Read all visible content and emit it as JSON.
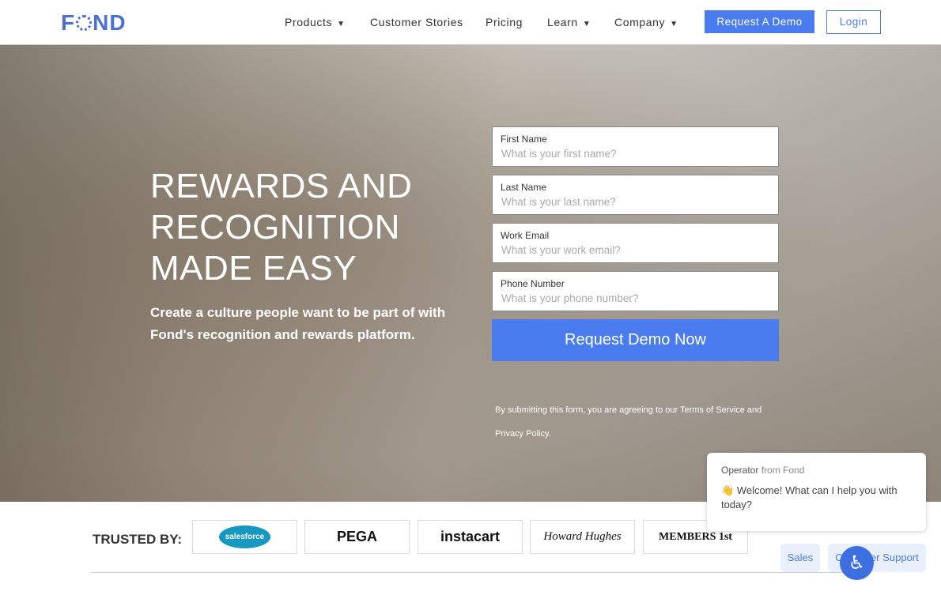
{
  "nav": {
    "logo": "FOND",
    "items": [
      {
        "label": "Products",
        "dropdown": true
      },
      {
        "label": "Customer Stories",
        "dropdown": false
      },
      {
        "label": "Pricing",
        "dropdown": false
      },
      {
        "label": "Learn",
        "dropdown": true
      },
      {
        "label": "Company",
        "dropdown": true
      }
    ],
    "request_demo": "Request A Demo",
    "login": "Login"
  },
  "hero": {
    "headline": [
      "REWARDS AND",
      "RECOGNITION",
      "MADE EASY"
    ],
    "subtitle": "Create a culture people want to be part of with Fond's recognition and rewards platform."
  },
  "form": {
    "fields": [
      {
        "label": "First Name",
        "placeholder": "What is your first name?"
      },
      {
        "label": "Last Name",
        "placeholder": "What is your last name?"
      },
      {
        "label": "Work Email",
        "placeholder": "What is your work email?"
      },
      {
        "label": "Phone Number",
        "placeholder": "What is your phone number?"
      }
    ],
    "submit": "Request Demo Now",
    "terms": "By submitting this form, you are agreeing to our Terms of Service and Privacy Policy."
  },
  "trusted": {
    "label": "TRUSTED BY:",
    "logos": [
      "salesforce",
      "PEGA",
      "instacart",
      "Howard Hughes",
      "MEMBERS 1st"
    ]
  },
  "chat": {
    "operator": "Operator",
    "from": "from Fond",
    "message": "👋 Welcome! What can I help you with today?",
    "buttons": [
      "Sales",
      "Customer Support"
    ]
  },
  "colors": {
    "accent": "#4a7cf0",
    "logo": "#4a72d4"
  }
}
